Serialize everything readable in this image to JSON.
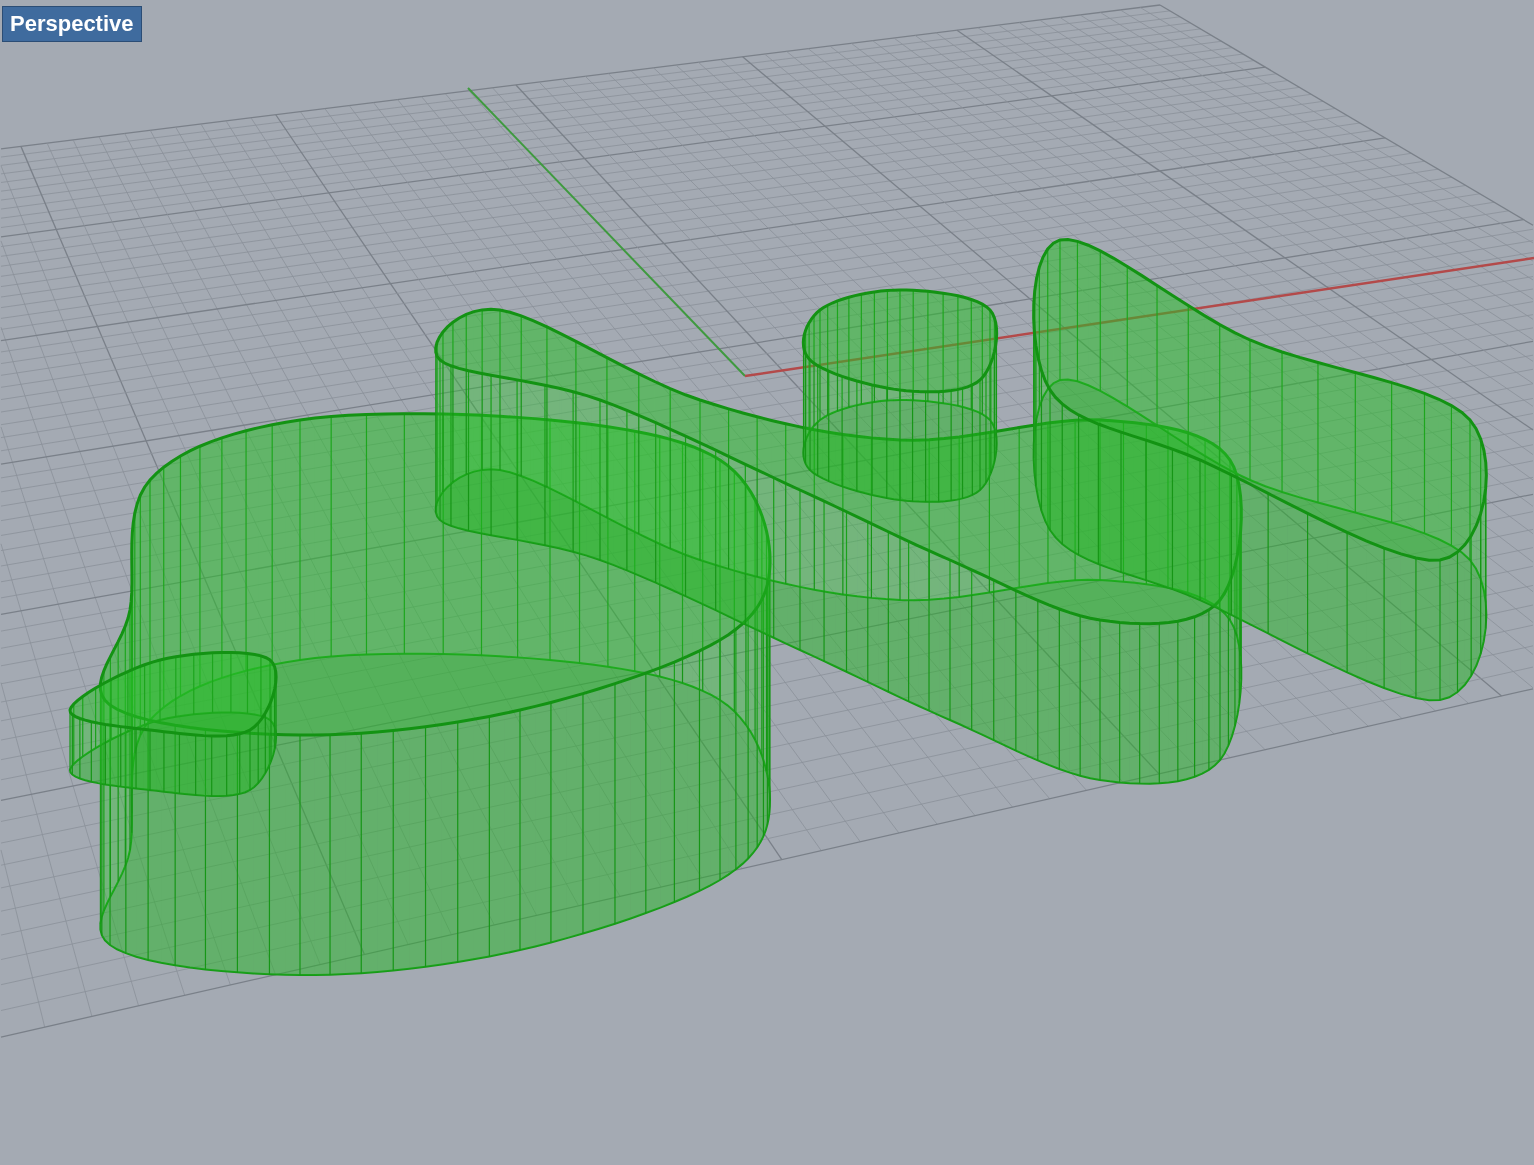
{
  "viewport": {
    "title": "Perspective"
  }
}
